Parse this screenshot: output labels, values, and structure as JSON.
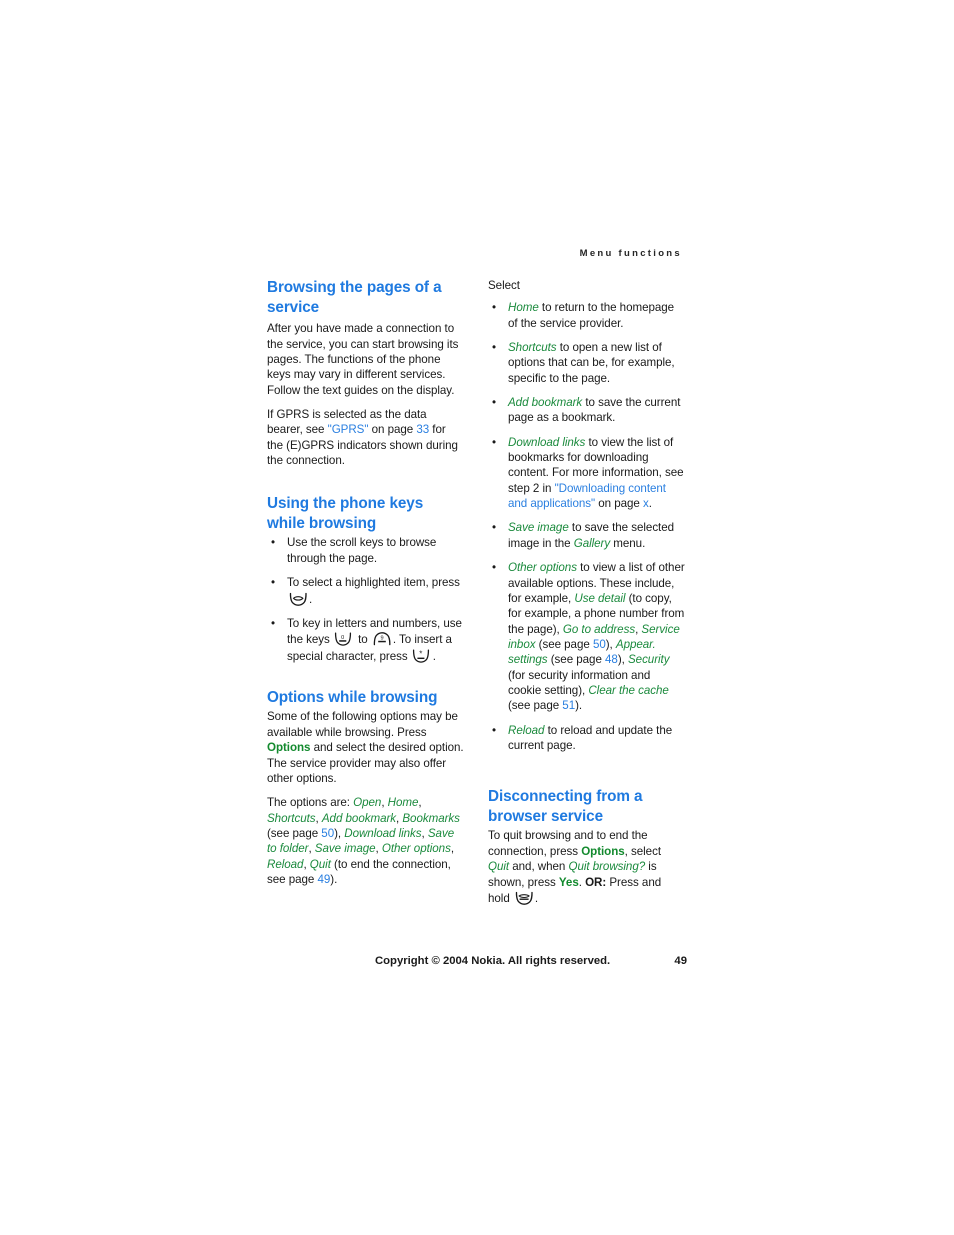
{
  "header": {
    "running_head": "Menu functions"
  },
  "left_column": {
    "heading_1": "Browsing the pages of a service",
    "para_1": "After you have made a connection to the service, you can start browsing its pages. The functions of the phone keys may vary in different services. Follow the text guides on the display.",
    "para_2_part1": "If GPRS is selected as the data bearer, see ",
    "para_2_gprs_ref": "\"GPRS\"",
    "para_2_part2": " on page ",
    "para_2_page": "33",
    "para_2_part3": " for the (E)GPRS indicators shown during the connection.",
    "heading_2": "Using the phone keys while browsing",
    "bullets": [
      {
        "text": "Use the scroll keys to browse through the page."
      },
      {
        "text_before": "To select a highlighted item, press ",
        "icon": "select-key-icon",
        "text_after": "."
      },
      {
        "text_before": "To key in letters and numbers, use the keys ",
        "icon_1": "key-0-icon",
        "text_mid": " to ",
        "icon_2": "key-9-icon",
        "text_mid2": ". To insert a special character, press ",
        "icon_3": "key-star-icon",
        "text_after": "."
      }
    ],
    "heading_3": "Options while browsing",
    "para_3_part1": "Some of the following options may be available while browsing. Press ",
    "para_3_options": "Options",
    "para_3_part2": " and select the desired option. The service provider may also offer other options.",
    "para_4_intro": "The options are: ",
    "para_4_options": [
      "Open",
      "Home",
      "Shortcuts",
      "Add bookmark",
      "Bookmarks"
    ],
    "para_4_see_page": "(see page ",
    "para_4_page_50": "50",
    "para_4_after_50": "), ",
    "para_4_options_2": [
      "Download links",
      "Save to folder",
      "Save image",
      "Other options",
      "Reload",
      "Quit"
    ],
    "para_4_tail": " (to end the connection, see page ",
    "para_4_page_49": "49",
    "para_4_end": ")."
  },
  "right_column": {
    "select_label": "Select",
    "bullets": [
      {
        "option": "Home",
        "text": " to return to the homepage of the service provider."
      },
      {
        "option": "Shortcuts",
        "text": " to open a new list of options that can be, for example, specific to the page."
      },
      {
        "option": "Add bookmark",
        "text": " to save the current page as a bookmark."
      },
      {
        "option": "Download links",
        "text_1": " to view the list of bookmarks for downloading content. For more information, see step 2 in ",
        "xref": "\"Downloading content and applications\"",
        "text_2": " on page ",
        "page": "x",
        "text_3": "."
      },
      {
        "option": "Save image",
        "text_1": " to save the selected image in the ",
        "option_2": "Gallery",
        "text_2": " menu."
      },
      {
        "option": "Other options",
        "text_1": " to view a list of other available options. These include, for example, ",
        "option_2": "Use detail",
        "text_2": " (to copy, for example, a phone number from the page), ",
        "option_3": "Go to address",
        "text_3": ", ",
        "option_4": "Service inbox",
        "text_4": " (see page ",
        "page_50": "50",
        "text_5": "), ",
        "option_5": "Appear. settings",
        "text_6": " (see page ",
        "page_48": "48",
        "text_7": "), ",
        "option_6": "Security",
        "text_8": " (for security information and cookie setting), ",
        "option_7": "Clear the cache",
        "text_9": " (see page ",
        "page_51": "51",
        "text_10": ")."
      },
      {
        "option": "Reload",
        "text": " to reload and update the current page."
      }
    ],
    "heading_1": "Disconnecting from a browser service",
    "para_1_part1": "To quit browsing and to end the connection, press ",
    "para_1_options": "Options",
    "para_1_part2": ", select ",
    "para_1_quit": "Quit",
    "para_1_part3": " and, when ",
    "para_1_quit_browsing": "Quit browsing?",
    "para_1_part4": " is shown, press ",
    "para_1_yes": "Yes",
    "para_1_part5": ". ",
    "para_1_or": "OR:",
    "para_1_part6": " Press and hold ",
    "para_1_icon": "end-call-key-icon",
    "para_1_part7": "."
  },
  "footer": {
    "copyright": "Copyright © 2004 Nokia. All rights reserved.",
    "page_number": "49"
  },
  "colors": {
    "heading_blue": "#1f7ae0",
    "option_green": "#1b8a3d",
    "xref_blue": "#2a7fe0",
    "body_text": "#1a1a1a"
  }
}
